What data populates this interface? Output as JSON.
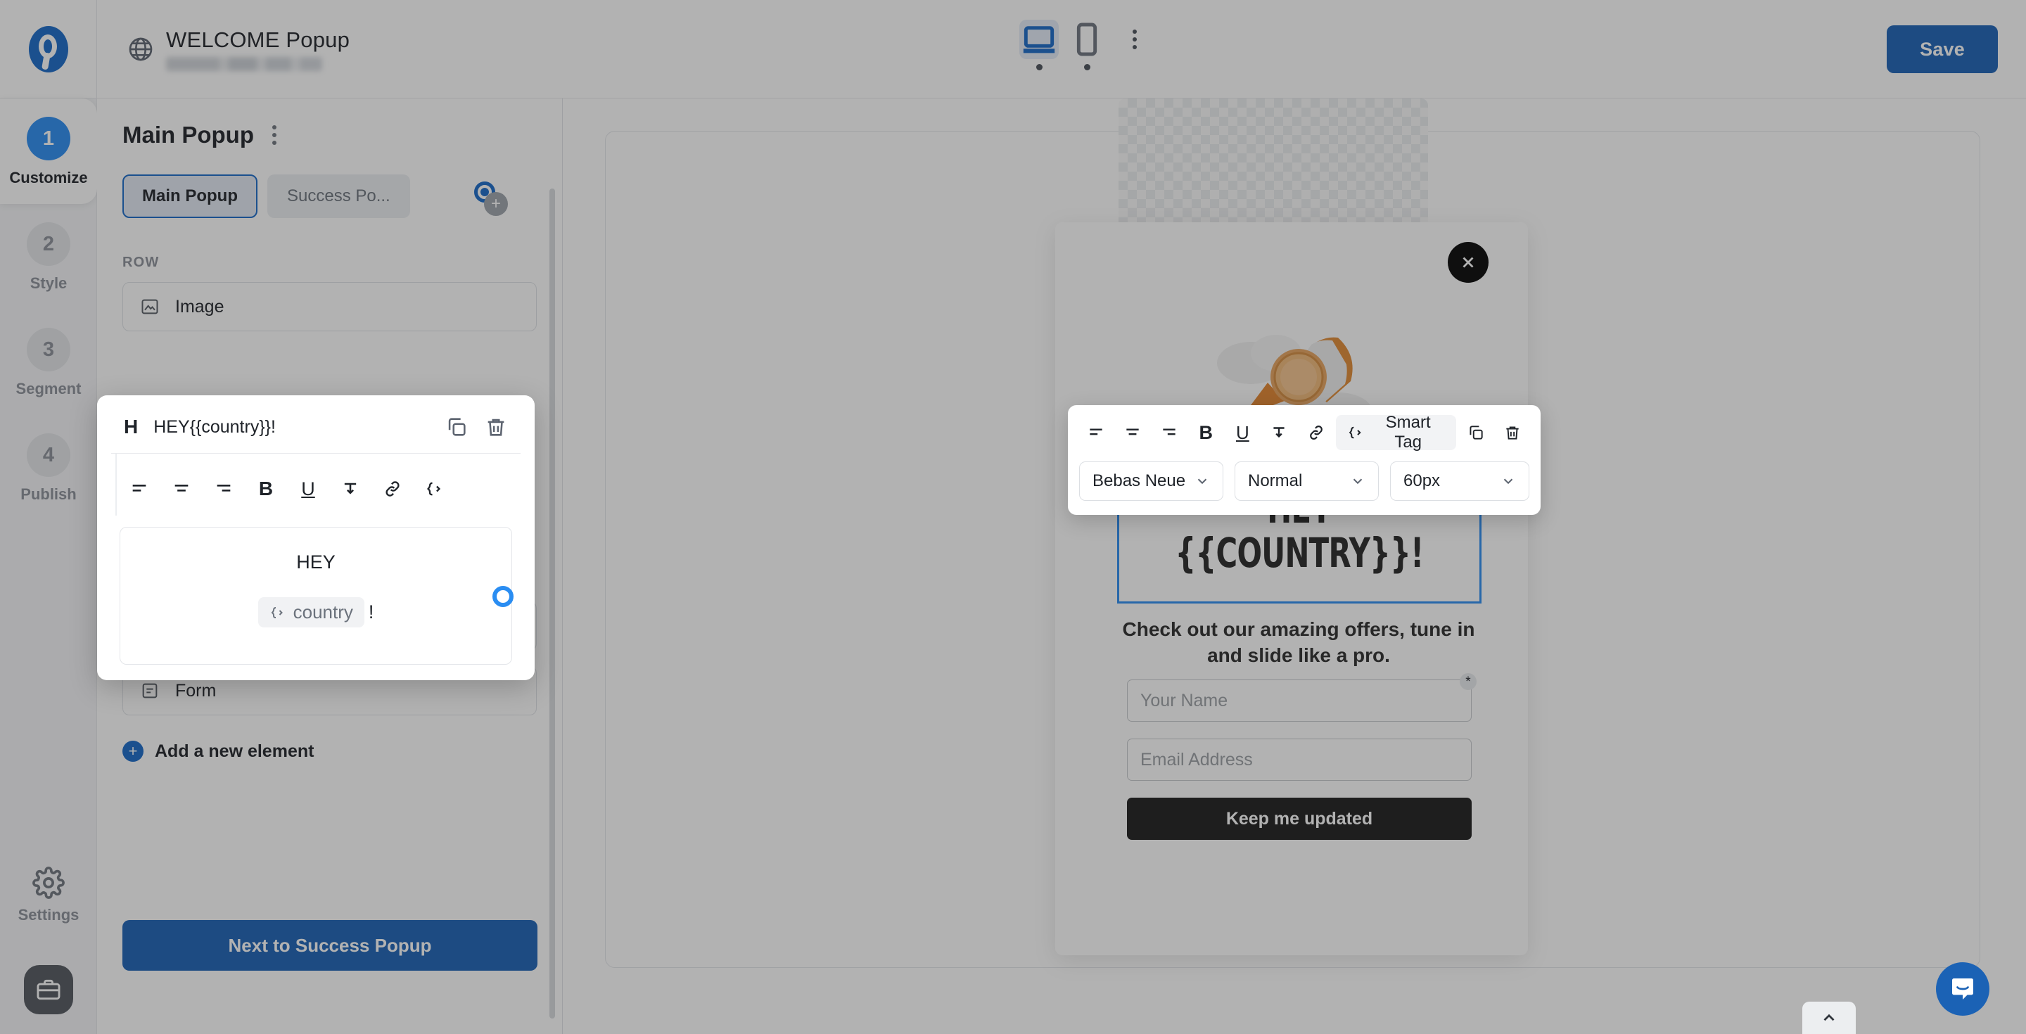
{
  "app": {
    "logo": "optimonk-logo-icon",
    "save_label": "Save"
  },
  "header": {
    "globe_icon": "globe-icon",
    "campaign_title": "WELCOME Popup",
    "domain_redacted": "",
    "devices": [
      {
        "name": "desktop",
        "icon": "desktop-icon",
        "active": true
      },
      {
        "name": "mobile",
        "icon": "mobile-icon",
        "active": false
      }
    ],
    "more_icon": "kebab-menu-icon"
  },
  "rail": {
    "steps": [
      {
        "number": "1",
        "label": "Customize",
        "active": true
      },
      {
        "number": "2",
        "label": "Style",
        "active": false
      },
      {
        "number": "3",
        "label": "Segment",
        "active": false
      },
      {
        "number": "4",
        "label": "Publish",
        "active": false
      }
    ],
    "settings_label": "Settings",
    "settings_icon": "gear-icon",
    "briefcase_icon": "briefcase-icon"
  },
  "panel": {
    "title": "Main Popup",
    "kebab_icon": "kebab-menu-icon",
    "add_page_icon": "plus-icon",
    "tabs": [
      {
        "label": "Main Popup",
        "active": true
      },
      {
        "label": "Success Po...",
        "active": false
      }
    ],
    "section_label": "ROW",
    "elements": [
      {
        "icon": "image-icon",
        "label": "Image"
      },
      {
        "icon": "text-icon",
        "label": "Check out our amazing offers, tune ..."
      },
      {
        "icon": "form-icon",
        "label": "Form"
      }
    ],
    "add_element_label": "Add a new element",
    "next_label": "Next to Success Popup"
  },
  "editor": {
    "type_badge": "H",
    "element_text": "HEY{{country}}!",
    "duplicate_icon": "copy-icon",
    "delete_icon": "trash-icon",
    "toolbar": [
      {
        "name": "align-left-icon",
        "label": ""
      },
      {
        "name": "align-center-icon",
        "label": ""
      },
      {
        "name": "align-right-icon",
        "label": ""
      },
      {
        "name": "bold-icon",
        "label": "B"
      },
      {
        "name": "underline-icon",
        "label": "U"
      },
      {
        "name": "vertical-align-icon",
        "label": ""
      },
      {
        "name": "link-icon",
        "label": ""
      },
      {
        "name": "smart-tag-icon",
        "label": ""
      }
    ],
    "preview_line1": "HEY",
    "preview_chip": "country",
    "preview_suffix": "!"
  },
  "canvas_toolbar": {
    "buttons": [
      {
        "name": "align-left-icon",
        "label": ""
      },
      {
        "name": "align-center-icon",
        "label": ""
      },
      {
        "name": "align-right-icon",
        "label": ""
      },
      {
        "name": "bold-icon",
        "label": "B"
      },
      {
        "name": "underline-icon",
        "label": "U"
      },
      {
        "name": "vertical-align-icon",
        "label": ""
      },
      {
        "name": "link-icon",
        "label": ""
      }
    ],
    "smart_tag_label": "Smart Tag",
    "smart_tag_icon": "smart-tag-icon",
    "duplicate_icon": "copy-icon",
    "delete_icon": "trash-icon",
    "font_family": "Bebas Neue",
    "font_weight": "Normal",
    "font_size": "60px"
  },
  "popup": {
    "close_icon": "close-icon",
    "image_alt": "rocket-illustration",
    "heading_line1": "HEY",
    "heading_line2": "{{COUNTRY}}!",
    "subheading": "Check out our amazing offers, tune in and slide like a pro.",
    "fields": [
      {
        "placeholder": "Your Name",
        "required_badge": "*"
      },
      {
        "placeholder": "Email Address",
        "required_badge": ""
      }
    ],
    "submit_label": "Keep me updated"
  },
  "footer": {
    "collapse_icon": "chevron-up-icon",
    "chat_icon": "chat-bubble-icon"
  },
  "colors": {
    "primary_blue": "#1b62b5",
    "accent_blue": "#2a8df2",
    "dark": "#1c1c1c",
    "panel_bg": "#ffffff",
    "rail_bg": "#f4f5f7"
  }
}
